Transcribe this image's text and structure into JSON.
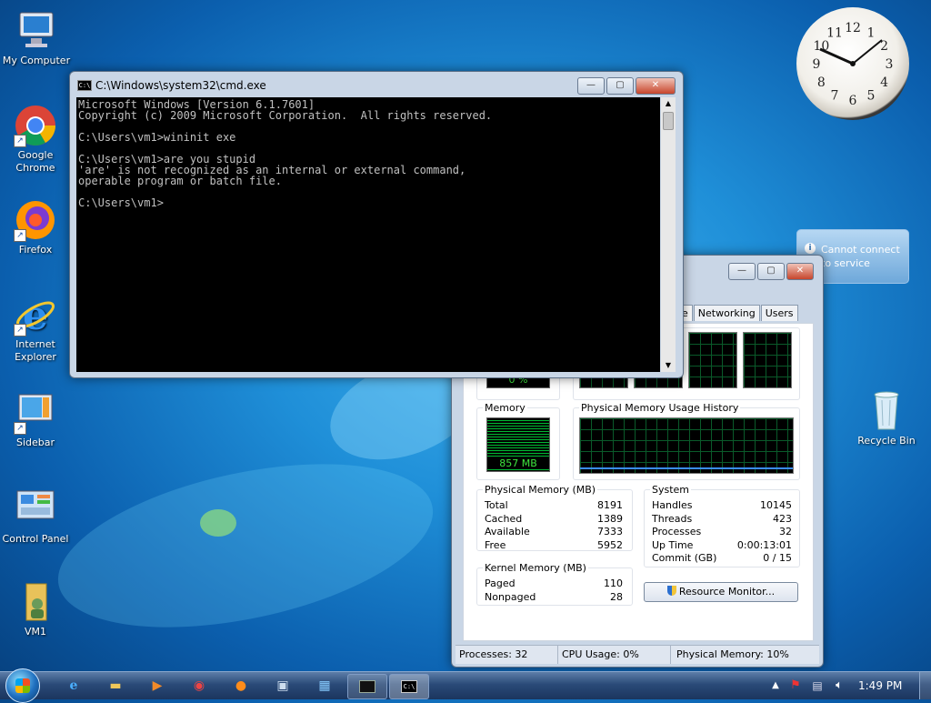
{
  "desktop": {
    "icons": [
      {
        "label": "My Computer",
        "icon": "computer-icon"
      },
      {
        "label": "Google Chrome",
        "icon": "chrome-icon"
      },
      {
        "label": "Firefox",
        "icon": "firefox-icon"
      },
      {
        "label": "Internet Explorer",
        "icon": "ie-icon"
      },
      {
        "label": "Sidebar",
        "icon": "sidebar-icon"
      },
      {
        "label": "Control Panel",
        "icon": "control-panel-icon"
      },
      {
        "label": "VM1",
        "icon": "user-folder-icon"
      },
      {
        "label": "Recycle Bin",
        "icon": "recycle-bin-icon"
      }
    ]
  },
  "clock": {
    "numbers": [
      "12",
      "1",
      "2",
      "3",
      "4",
      "5",
      "6",
      "7",
      "8",
      "9",
      "10",
      "11"
    ]
  },
  "notify": {
    "text": "Cannot connect to service"
  },
  "cmd": {
    "title": "C:\\Windows\\system32\\cmd.exe",
    "lines": [
      "Microsoft Windows [Version 6.1.7601]",
      "Copyright (c) 2009 Microsoft Corporation.  All rights reserved.",
      "",
      "C:\\Users\\vm1>wininit exe",
      "",
      "C:\\Users\\vm1>are you stupid",
      "'are' is not recognized as an internal or external command,",
      "operable program or batch file.",
      "",
      "C:\\Users\\vm1>"
    ]
  },
  "taskmgr": {
    "tabs": [
      "e",
      "Networking",
      "Users"
    ],
    "cpu_usage_value": "0 %",
    "memory_label": "Memory",
    "memory_value": "857 MB",
    "memory_history_label": "Physical Memory Usage History",
    "physical_memory": {
      "title": "Physical Memory (MB)",
      "rows": [
        {
          "k": "Total",
          "v": "8191"
        },
        {
          "k": "Cached",
          "v": "1389"
        },
        {
          "k": "Available",
          "v": "7333"
        },
        {
          "k": "Free",
          "v": "5952"
        }
      ]
    },
    "kernel_memory": {
      "title": "Kernel Memory (MB)",
      "rows": [
        {
          "k": "Paged",
          "v": "110"
        },
        {
          "k": "Nonpaged",
          "v": "28"
        }
      ]
    },
    "system": {
      "title": "System",
      "rows": [
        {
          "k": "Handles",
          "v": "10145"
        },
        {
          "k": "Threads",
          "v": "423"
        },
        {
          "k": "Processes",
          "v": "32"
        },
        {
          "k": "Up Time",
          "v": "0:00:13:01"
        },
        {
          "k": "Commit (GB)",
          "v": "0 / 15"
        }
      ]
    },
    "resource_monitor_label": "Resource Monitor...",
    "status": {
      "processes": "Processes: 32",
      "cpu": "CPU Usage: 0%",
      "memory": "Physical Memory: 10%"
    }
  },
  "taskbar": {
    "time": "1:49 PM"
  }
}
